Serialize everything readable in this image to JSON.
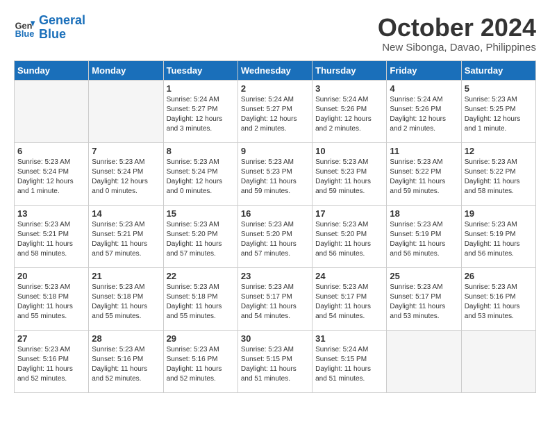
{
  "header": {
    "logo_line1": "General",
    "logo_line2": "Blue",
    "month": "October 2024",
    "location": "New Sibonga, Davao, Philippines"
  },
  "weekdays": [
    "Sunday",
    "Monday",
    "Tuesday",
    "Wednesday",
    "Thursday",
    "Friday",
    "Saturday"
  ],
  "weeks": [
    [
      {
        "day": "",
        "empty": true
      },
      {
        "day": "",
        "empty": true
      },
      {
        "day": "1",
        "sunrise": "5:24 AM",
        "sunset": "5:27 PM",
        "daylight": "12 hours and 3 minutes."
      },
      {
        "day": "2",
        "sunrise": "5:24 AM",
        "sunset": "5:27 PM",
        "daylight": "12 hours and 2 minutes."
      },
      {
        "day": "3",
        "sunrise": "5:24 AM",
        "sunset": "5:26 PM",
        "daylight": "12 hours and 2 minutes."
      },
      {
        "day": "4",
        "sunrise": "5:24 AM",
        "sunset": "5:26 PM",
        "daylight": "12 hours and 2 minutes."
      },
      {
        "day": "5",
        "sunrise": "5:23 AM",
        "sunset": "5:25 PM",
        "daylight": "12 hours and 1 minute."
      }
    ],
    [
      {
        "day": "6",
        "sunrise": "5:23 AM",
        "sunset": "5:24 PM",
        "daylight": "12 hours and 1 minute."
      },
      {
        "day": "7",
        "sunrise": "5:23 AM",
        "sunset": "5:24 PM",
        "daylight": "12 hours and 0 minutes."
      },
      {
        "day": "8",
        "sunrise": "5:23 AM",
        "sunset": "5:24 PM",
        "daylight": "12 hours and 0 minutes."
      },
      {
        "day": "9",
        "sunrise": "5:23 AM",
        "sunset": "5:23 PM",
        "daylight": "11 hours and 59 minutes."
      },
      {
        "day": "10",
        "sunrise": "5:23 AM",
        "sunset": "5:23 PM",
        "daylight": "11 hours and 59 minutes."
      },
      {
        "day": "11",
        "sunrise": "5:23 AM",
        "sunset": "5:22 PM",
        "daylight": "11 hours and 59 minutes."
      },
      {
        "day": "12",
        "sunrise": "5:23 AM",
        "sunset": "5:22 PM",
        "daylight": "11 hours and 58 minutes."
      }
    ],
    [
      {
        "day": "13",
        "sunrise": "5:23 AM",
        "sunset": "5:21 PM",
        "daylight": "11 hours and 58 minutes."
      },
      {
        "day": "14",
        "sunrise": "5:23 AM",
        "sunset": "5:21 PM",
        "daylight": "11 hours and 57 minutes."
      },
      {
        "day": "15",
        "sunrise": "5:23 AM",
        "sunset": "5:20 PM",
        "daylight": "11 hours and 57 minutes."
      },
      {
        "day": "16",
        "sunrise": "5:23 AM",
        "sunset": "5:20 PM",
        "daylight": "11 hours and 57 minutes."
      },
      {
        "day": "17",
        "sunrise": "5:23 AM",
        "sunset": "5:20 PM",
        "daylight": "11 hours and 56 minutes."
      },
      {
        "day": "18",
        "sunrise": "5:23 AM",
        "sunset": "5:19 PM",
        "daylight": "11 hours and 56 minutes."
      },
      {
        "day": "19",
        "sunrise": "5:23 AM",
        "sunset": "5:19 PM",
        "daylight": "11 hours and 56 minutes."
      }
    ],
    [
      {
        "day": "20",
        "sunrise": "5:23 AM",
        "sunset": "5:18 PM",
        "daylight": "11 hours and 55 minutes."
      },
      {
        "day": "21",
        "sunrise": "5:23 AM",
        "sunset": "5:18 PM",
        "daylight": "11 hours and 55 minutes."
      },
      {
        "day": "22",
        "sunrise": "5:23 AM",
        "sunset": "5:18 PM",
        "daylight": "11 hours and 55 minutes."
      },
      {
        "day": "23",
        "sunrise": "5:23 AM",
        "sunset": "5:17 PM",
        "daylight": "11 hours and 54 minutes."
      },
      {
        "day": "24",
        "sunrise": "5:23 AM",
        "sunset": "5:17 PM",
        "daylight": "11 hours and 54 minutes."
      },
      {
        "day": "25",
        "sunrise": "5:23 AM",
        "sunset": "5:17 PM",
        "daylight": "11 hours and 53 minutes."
      },
      {
        "day": "26",
        "sunrise": "5:23 AM",
        "sunset": "5:16 PM",
        "daylight": "11 hours and 53 minutes."
      }
    ],
    [
      {
        "day": "27",
        "sunrise": "5:23 AM",
        "sunset": "5:16 PM",
        "daylight": "11 hours and 52 minutes."
      },
      {
        "day": "28",
        "sunrise": "5:23 AM",
        "sunset": "5:16 PM",
        "daylight": "11 hours and 52 minutes."
      },
      {
        "day": "29",
        "sunrise": "5:23 AM",
        "sunset": "5:16 PM",
        "daylight": "11 hours and 52 minutes."
      },
      {
        "day": "30",
        "sunrise": "5:23 AM",
        "sunset": "5:15 PM",
        "daylight": "11 hours and 51 minutes."
      },
      {
        "day": "31",
        "sunrise": "5:24 AM",
        "sunset": "5:15 PM",
        "daylight": "11 hours and 51 minutes."
      },
      {
        "day": "",
        "empty": true
      },
      {
        "day": "",
        "empty": true
      }
    ]
  ]
}
